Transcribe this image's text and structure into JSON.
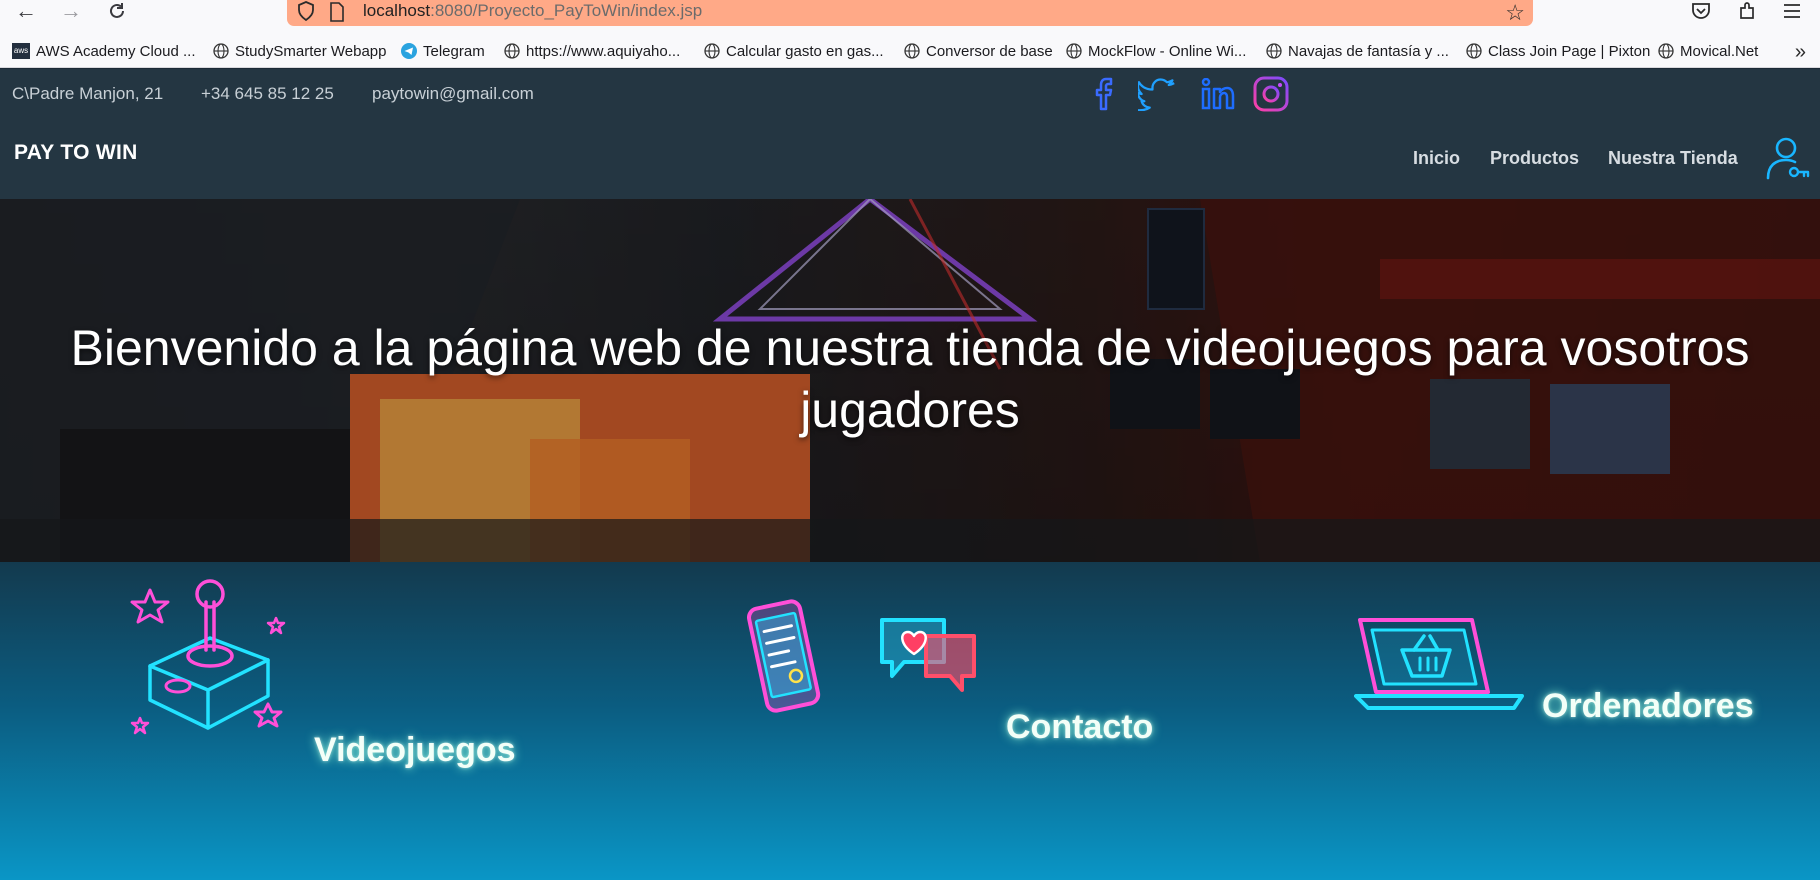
{
  "browser": {
    "url_host": "localhost",
    "url_path": ":8080/Proyecto_PayToWin/index.jsp",
    "bookmarks": [
      {
        "label": "AWS Academy Cloud ...",
        "icon": "aws-icon"
      },
      {
        "label": "StudySmarter Webapp",
        "icon": "globe-icon"
      },
      {
        "label": "Telegram",
        "icon": "telegram-icon"
      },
      {
        "label": "https://www.aquiyaho...",
        "icon": "globe-icon"
      },
      {
        "label": "Calcular gasto en gas...",
        "icon": "globe-icon"
      },
      {
        "label": "Conversor de base",
        "icon": "globe-icon"
      },
      {
        "label": "MockFlow - Online Wi...",
        "icon": "globe-icon"
      },
      {
        "label": "Navajas de fantasía y ...",
        "icon": "globe-icon"
      },
      {
        "label": "Class Join Page | Pixton",
        "icon": "globe-icon"
      },
      {
        "label": "Movical.Net",
        "icon": "globe-icon"
      }
    ],
    "overflow": "»"
  },
  "topbar": {
    "address": "C\\Padre Manjon, 21",
    "phone": "+34 645 85 12 25",
    "email": "paytowin@gmail.com",
    "social": [
      "facebook-icon",
      "twitter-icon",
      "linkedin-icon",
      "instagram-icon"
    ]
  },
  "nav": {
    "brand": "PAY TO WIN",
    "links": [
      "Inicio",
      "Productos",
      "Nuestra Tienda"
    ]
  },
  "hero": {
    "title_line1": "Bienvenido a la página web de nuestra tienda de videojuegos para vosotros",
    "title_line2": "jugadores"
  },
  "features": [
    {
      "label": "Videojuegos",
      "icon": "joystick-icon"
    },
    {
      "label": "Contacto",
      "icon": "phone-chat-icon"
    },
    {
      "label": "Ordenadores",
      "icon": "laptop-basket-icon"
    }
  ],
  "colors": {
    "url_bar": "#ffa987",
    "site_bar": "#243642",
    "neon_cyan": "#22d6ff",
    "neon_pink": "#ff4fd8"
  }
}
